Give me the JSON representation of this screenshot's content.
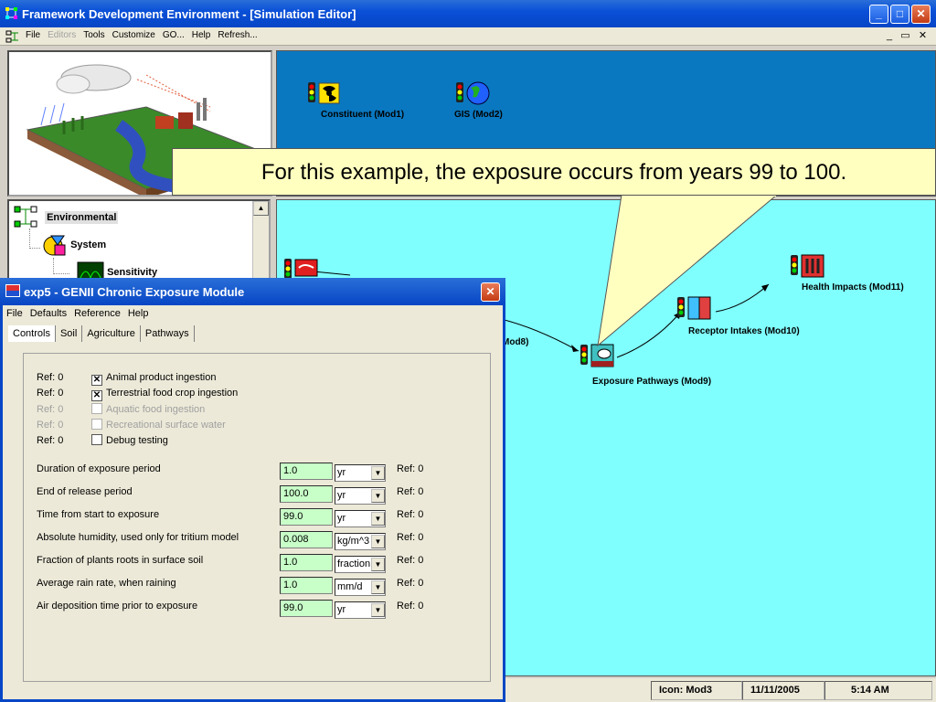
{
  "window": {
    "title": "Framework Development Environment - [Simulation Editor]",
    "menu": [
      {
        "label": "File",
        "disabled": false
      },
      {
        "label": "Editors",
        "disabled": true
      },
      {
        "label": "Tools",
        "disabled": false
      },
      {
        "label": "Customize",
        "disabled": false
      },
      {
        "label": "GO...",
        "disabled": false
      },
      {
        "label": "Help",
        "disabled": false
      },
      {
        "label": "Refresh...",
        "disabled": false
      }
    ]
  },
  "tree": {
    "items": [
      "Environmental",
      "System",
      "Sensitivity"
    ]
  },
  "canvas_top": {
    "modules": [
      {
        "label": "Constituent (Mod1)",
        "icon": "radiation-icon"
      },
      {
        "label": "GIS (Mod2)",
        "icon": "globe-icon"
      }
    ]
  },
  "canvas": {
    "modules": [
      {
        "label": "Mod8)",
        "icon": "module-icon"
      },
      {
        "label": "Exposure Pathways (Mod9)",
        "icon": "exposure-icon"
      },
      {
        "label": "Receptor Intakes (Mod10)",
        "icon": "intake-icon"
      },
      {
        "label": "Health Impacts (Mod11)",
        "icon": "health-icon"
      }
    ]
  },
  "callout": "For this example, the exposure occurs from years 99 to 100.",
  "status": {
    "icon": "Icon: Mod3",
    "date": "11/11/2005",
    "time": "5:14 AM"
  },
  "dialog": {
    "title": "exp5 - GENII Chronic Exposure Module",
    "menu": [
      "File",
      "Defaults",
      "Reference",
      "Help"
    ],
    "tabs": [
      "Controls",
      "Soil",
      "Agriculture",
      "Pathways"
    ],
    "active_tab": "Controls",
    "checkboxes": [
      {
        "ref": "Ref: 0",
        "label": "Animal product ingestion",
        "checked": true,
        "disabled": false
      },
      {
        "ref": "Ref: 0",
        "label": "Terrestrial food crop ingestion",
        "checked": true,
        "disabled": false
      },
      {
        "ref": "Ref: 0",
        "label": "Aquatic food ingestion",
        "checked": false,
        "disabled": true
      },
      {
        "ref": "Ref: 0",
        "label": "Recreational surface water",
        "checked": false,
        "disabled": true
      },
      {
        "ref": "Ref: 0",
        "label": "Debug testing",
        "checked": false,
        "disabled": false
      }
    ],
    "params": [
      {
        "label": "Duration of exposure period",
        "value": "1.0",
        "unit": "yr",
        "ref": "Ref:  0"
      },
      {
        "label": "End of release period",
        "value": "100.0",
        "unit": "yr",
        "ref": "Ref:  0"
      },
      {
        "label": "Time from start to exposure",
        "value": "99.0",
        "unit": "yr",
        "ref": "Ref:  0"
      },
      {
        "label": "Absolute humidity, used only for tritium model",
        "value": "0.008",
        "unit": "kg/m^3",
        "ref": "Ref:  0"
      },
      {
        "label": "Fraction of plants roots in surface soil",
        "value": "1.0",
        "unit": "fraction",
        "ref": "Ref:  0"
      },
      {
        "label": "Average rain rate, when raining",
        "value": "1.0",
        "unit": "mm/d",
        "ref": "Ref:  0"
      },
      {
        "label": "Air deposition time prior to exposure",
        "value": "99.0",
        "unit": "yr",
        "ref": "Ref:  0"
      }
    ]
  },
  "colors": {
    "titlebar": "#0a50d8",
    "canvas_top": "#0a78c0",
    "canvas_bottom": "#80ffff",
    "callout": "#ffffc0",
    "field": "#c8ffc8"
  }
}
